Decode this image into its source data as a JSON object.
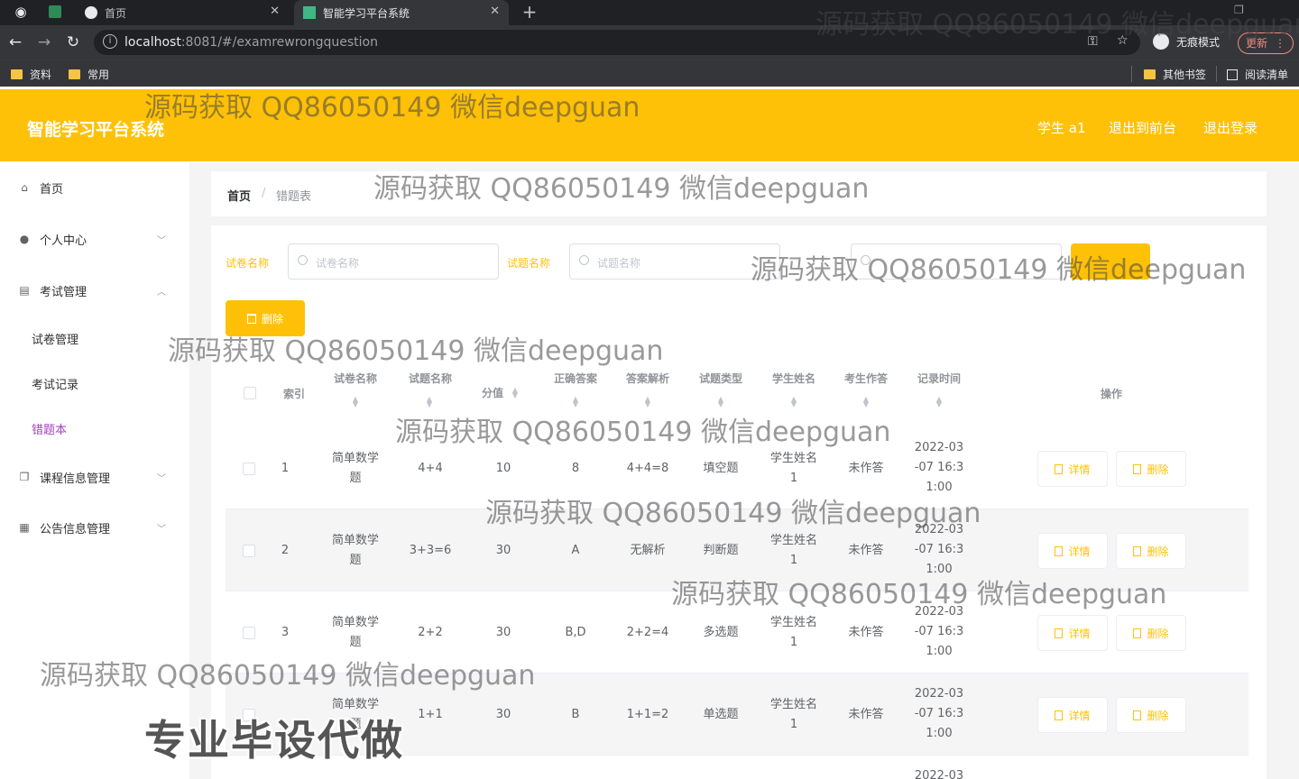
{
  "browser": {
    "tabs": [
      {
        "label": "首页"
      },
      {
        "label": "智能学习平台系统"
      }
    ],
    "url_host": "localhost",
    "url_rest": ":8081/#/examrewrongquestion",
    "incognito_label": "无痕模式",
    "update_label": "更新",
    "bookmarks": [
      "资料",
      "常用"
    ],
    "bookmarks_right": [
      "其他书签",
      "阅读清单"
    ]
  },
  "header": {
    "title": "智能学习平台系统",
    "user": "学生 a1",
    "back_front": "退出到前台",
    "logout": "退出登录",
    "accent": "#ffc107"
  },
  "sidebar": {
    "items": [
      {
        "label": "首页",
        "icon": "home-icon"
      },
      {
        "label": "个人中心",
        "icon": "user-icon"
      },
      {
        "label": "考试管理",
        "icon": "chat-icon"
      },
      {
        "label": "课程信息管理",
        "icon": "copy-icon"
      },
      {
        "label": "公告信息管理",
        "icon": "calendar-icon"
      }
    ],
    "sub_items": [
      "试卷管理",
      "考试记录",
      "错题本"
    ]
  },
  "breadcrumb": {
    "home": "首页",
    "sep": "/",
    "current": "错题表"
  },
  "filters": [
    {
      "label": "试卷名称",
      "placeholder": "试卷名称"
    },
    {
      "label": "试题名称",
      "placeholder": "试题名称"
    }
  ],
  "delete_label": "删除",
  "table": {
    "columns": [
      "索引",
      "试卷名称",
      "试题名称",
      "分值",
      "正确答案",
      "答案解析",
      "试题类型",
      "学生姓名",
      "考生作答",
      "记录时间",
      "操作"
    ],
    "rows": [
      {
        "index": "1",
        "paper": [
          "简单数学",
          "题"
        ],
        "question": "4+4",
        "score": "10",
        "answer": "8",
        "analysis": "4+4=8",
        "type": "填空题",
        "student": [
          "学生姓名",
          "1"
        ],
        "response": "未作答",
        "time": [
          "2022-03",
          "-07 16:3",
          "1:00"
        ]
      },
      {
        "index": "2",
        "paper": [
          "简单数学",
          "题"
        ],
        "question": "3+3=6",
        "score": "30",
        "answer": "A",
        "analysis": "无解析",
        "type": "判断题",
        "student": [
          "学生姓名",
          "1"
        ],
        "response": "未作答",
        "time": [
          "2022-03",
          "-07 16:3",
          "1:00"
        ]
      },
      {
        "index": "3",
        "paper": [
          "简单数学",
          "题"
        ],
        "question": "2+2",
        "score": "30",
        "answer": "B,D",
        "analysis": "2+2=4",
        "type": "多选题",
        "student": [
          "学生姓名",
          "1"
        ],
        "response": "未作答",
        "time": [
          "2022-03",
          "-07 16:3",
          "1:00"
        ]
      },
      {
        "index": "4",
        "paper": [
          "简单数学",
          "题"
        ],
        "question": "1+1",
        "score": "30",
        "answer": "B",
        "analysis": "1+1=2",
        "type": "单选题",
        "student": [
          "学生姓名",
          "1"
        ],
        "response": "未作答",
        "time": [
          "2022-03",
          "-07 16:3",
          "1:00"
        ]
      },
      {
        "time_partial": "2022-03"
      }
    ],
    "detail_label": "详情",
    "delete_label": "删除"
  },
  "watermark": "源码获取 QQ86050149 微信deepguan",
  "watermark_big": "专业毕设代做"
}
